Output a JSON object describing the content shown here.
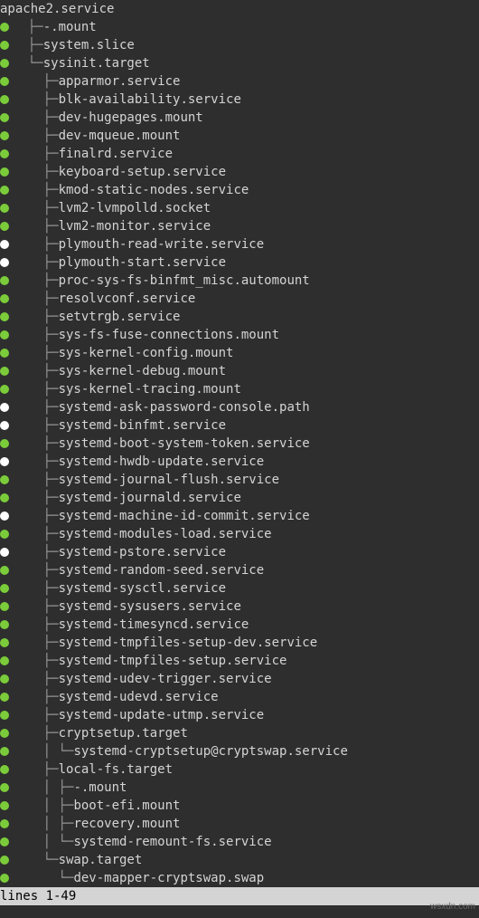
{
  "status_bar": "lines 1-49",
  "watermark": "wsxdn.com",
  "rows": [
    {
      "dot": null,
      "tree": "",
      "label": "apache2.service"
    },
    {
      "dot": "green",
      "tree": "  ├─",
      "label": "-.mount"
    },
    {
      "dot": "green",
      "tree": "  ├─",
      "label": "system.slice"
    },
    {
      "dot": "green",
      "tree": "  └─",
      "label": "sysinit.target"
    },
    {
      "dot": "green",
      "tree": "    ├─",
      "label": "apparmor.service"
    },
    {
      "dot": "green",
      "tree": "    ├─",
      "label": "blk-availability.service"
    },
    {
      "dot": "green",
      "tree": "    ├─",
      "label": "dev-hugepages.mount"
    },
    {
      "dot": "green",
      "tree": "    ├─",
      "label": "dev-mqueue.mount"
    },
    {
      "dot": "green",
      "tree": "    ├─",
      "label": "finalrd.service"
    },
    {
      "dot": "green",
      "tree": "    ├─",
      "label": "keyboard-setup.service"
    },
    {
      "dot": "green",
      "tree": "    ├─",
      "label": "kmod-static-nodes.service"
    },
    {
      "dot": "green",
      "tree": "    ├─",
      "label": "lvm2-lvmpolld.socket"
    },
    {
      "dot": "green",
      "tree": "    ├─",
      "label": "lvm2-monitor.service"
    },
    {
      "dot": "white",
      "tree": "    ├─",
      "label": "plymouth-read-write.service"
    },
    {
      "dot": "white",
      "tree": "    ├─",
      "label": "plymouth-start.service"
    },
    {
      "dot": "green",
      "tree": "    ├─",
      "label": "proc-sys-fs-binfmt_misc.automount"
    },
    {
      "dot": "green",
      "tree": "    ├─",
      "label": "resolvconf.service"
    },
    {
      "dot": "green",
      "tree": "    ├─",
      "label": "setvtrgb.service"
    },
    {
      "dot": "green",
      "tree": "    ├─",
      "label": "sys-fs-fuse-connections.mount"
    },
    {
      "dot": "green",
      "tree": "    ├─",
      "label": "sys-kernel-config.mount"
    },
    {
      "dot": "green",
      "tree": "    ├─",
      "label": "sys-kernel-debug.mount"
    },
    {
      "dot": "green",
      "tree": "    ├─",
      "label": "sys-kernel-tracing.mount"
    },
    {
      "dot": "white",
      "tree": "    ├─",
      "label": "systemd-ask-password-console.path"
    },
    {
      "dot": "white",
      "tree": "    ├─",
      "label": "systemd-binfmt.service"
    },
    {
      "dot": "green",
      "tree": "    ├─",
      "label": "systemd-boot-system-token.service"
    },
    {
      "dot": "white",
      "tree": "    ├─",
      "label": "systemd-hwdb-update.service"
    },
    {
      "dot": "green",
      "tree": "    ├─",
      "label": "systemd-journal-flush.service"
    },
    {
      "dot": "green",
      "tree": "    ├─",
      "label": "systemd-journald.service"
    },
    {
      "dot": "white",
      "tree": "    ├─",
      "label": "systemd-machine-id-commit.service"
    },
    {
      "dot": "green",
      "tree": "    ├─",
      "label": "systemd-modules-load.service"
    },
    {
      "dot": "white",
      "tree": "    ├─",
      "label": "systemd-pstore.service"
    },
    {
      "dot": "green",
      "tree": "    ├─",
      "label": "systemd-random-seed.service"
    },
    {
      "dot": "green",
      "tree": "    ├─",
      "label": "systemd-sysctl.service"
    },
    {
      "dot": "green",
      "tree": "    ├─",
      "label": "systemd-sysusers.service"
    },
    {
      "dot": "green",
      "tree": "    ├─",
      "label": "systemd-timesyncd.service"
    },
    {
      "dot": "green",
      "tree": "    ├─",
      "label": "systemd-tmpfiles-setup-dev.service"
    },
    {
      "dot": "green",
      "tree": "    ├─",
      "label": "systemd-tmpfiles-setup.service"
    },
    {
      "dot": "green",
      "tree": "    ├─",
      "label": "systemd-udev-trigger.service"
    },
    {
      "dot": "green",
      "tree": "    ├─",
      "label": "systemd-udevd.service"
    },
    {
      "dot": "green",
      "tree": "    ├─",
      "label": "systemd-update-utmp.service"
    },
    {
      "dot": "green",
      "tree": "    ├─",
      "label": "cryptsetup.target"
    },
    {
      "dot": "green",
      "tree": "    │ └─",
      "label": "systemd-cryptsetup@cryptswap.service"
    },
    {
      "dot": "green",
      "tree": "    ├─",
      "label": "local-fs.target"
    },
    {
      "dot": "green",
      "tree": "    │ ├─",
      "label": "-.mount"
    },
    {
      "dot": "green",
      "tree": "    │ ├─",
      "label": "boot-efi.mount"
    },
    {
      "dot": "green",
      "tree": "    │ ├─",
      "label": "recovery.mount"
    },
    {
      "dot": "green",
      "tree": "    │ └─",
      "label": "systemd-remount-fs.service"
    },
    {
      "dot": "green",
      "tree": "    └─",
      "label": "swap.target"
    },
    {
      "dot": "green",
      "tree": "      └─",
      "label": "dev-mapper-cryptswap.swap"
    }
  ]
}
